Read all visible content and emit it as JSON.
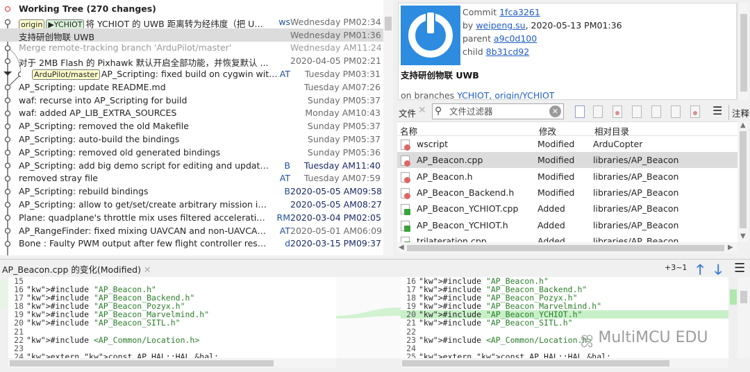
{
  "log": {
    "rows": [
      {
        "subject": "Working Tree (270 changes)",
        "author": "",
        "date": "",
        "style": "bold",
        "dot": "red"
      },
      {
        "tags": [
          "origin",
          "▶YCHIOT"
        ],
        "subject": "将 YCHIOT 的 UWB 距离转为经纬度（把 UWB ...",
        "author": "ws",
        "date": "Wednesday PM02:34"
      },
      {
        "subject": "支持研创物联 UWB",
        "author": "",
        "date": "Wednesday PM01:36",
        "selected": true
      },
      {
        "subject": "Merge remote-tracking branch 'ArduPilot/master'",
        "author": "",
        "date": "Wednesday AM11:24",
        "style": "dim"
      },
      {
        "subject": "对于 2MB Flash 的 Pixhawk 默认开启全部功能，并恢复默认 ...",
        "author": "",
        "date": "2020-04-05 PM02:21"
      },
      {
        "tags": [
          "ArduPilot/master"
        ],
        "subject": "AP_Scripting: fixed build on cygwin with ...",
        "author": "AT",
        "date": "Tuesday PM03:31"
      },
      {
        "subject": "AP_Scripting: update README.md",
        "author": "",
        "date": "Tuesday AM07:26"
      },
      {
        "subject": "waf: recurse into AP_Scripting for build",
        "author": "",
        "date": "Sunday PM05:37"
      },
      {
        "subject": "waf: added AP_LIB_EXTRA_SOURCES",
        "author": "",
        "date": "Monday AM10:43"
      },
      {
        "subject": "AP_Scripting: removed the old Makefile",
        "author": "",
        "date": "Sunday PM05:37"
      },
      {
        "subject": "AP_Scripting: auto-build the bindings",
        "author": "",
        "date": "Sunday PM05:37"
      },
      {
        "subject": "AP_Scripting: removed old generated bindings",
        "author": "",
        "date": "Sunday PM05:36"
      },
      {
        "subject": "AP_Scripting: add big demo script for editing and updating ...",
        "author": "B",
        "date": "Tuesday AM11:40",
        "dark": true
      },
      {
        "subject": "removed stray file",
        "author": "AT",
        "date": "Tuesday AM07:59"
      },
      {
        "subject": "AP_Scripting: rebuild bindings",
        "author": "B",
        "date": "2020-05-05 AM09:58",
        "dark": true
      },
      {
        "subject": "AP_Scripting: allow to get/set/create arbitrary mission items",
        "author": "",
        "date": "2020-05-05 AM08:27",
        "dark": true
      },
      {
        "subject": "Plane: quadplane's throttle mix uses filtered accelerations",
        "author": "RM",
        "date": "2020-03-04 PM02:05",
        "dark": true
      },
      {
        "subject": "AP_RangeFinder: fixed mixing UAVCAN and non-UAVCAN ra...",
        "author": "AT",
        "date": "2020-05-01 AM06:09"
      },
      {
        "subject": "Bone : Faulty PWM output after few flight controller restarts ...",
        "author": "d",
        "date": "2020-03-15 PM09:37",
        "dark": true
      }
    ]
  },
  "details": {
    "commit_label": "Commit",
    "commit": "1fca3261",
    "by_label": "by",
    "author": "weipeng.su",
    "author_date": ", 2020-05-13 PM01:36",
    "parent_label": "parent",
    "parent": "a9c0d100",
    "child_label": "child",
    "child": "8b31cd92",
    "title": "支持研创物联 UWB",
    "branches_label": "on branches",
    "branches": "YCHIOT, origin/YCHIOT"
  },
  "files_toolbar": {
    "label": "文件",
    "filter_placeholder": "文件过滤器",
    "annotate": "注释"
  },
  "files": {
    "columns": [
      "名称",
      "修改",
      "相对目录"
    ],
    "rows": [
      {
        "name": "wscript",
        "status": "Modified",
        "dir": "ArduCopter",
        "kind": "mod"
      },
      {
        "name": "AP_Beacon.cpp",
        "status": "Modified",
        "dir": "libraries/AP_Beacon",
        "kind": "mod",
        "selected": true
      },
      {
        "name": "AP_Beacon.h",
        "status": "Modified",
        "dir": "libraries/AP_Beacon",
        "kind": "mod"
      },
      {
        "name": "AP_Beacon_Backend.h",
        "status": "Modified",
        "dir": "libraries/AP_Beacon",
        "kind": "mod"
      },
      {
        "name": "AP_Beacon_YCHIOT.cpp",
        "status": "Added",
        "dir": "libraries/AP_Beacon",
        "kind": "add"
      },
      {
        "name": "AP_Beacon_YCHIOT.h",
        "status": "Added",
        "dir": "libraries/AP_Beacon",
        "kind": "add"
      },
      {
        "name": "trilateration.cpp",
        "status": "Added",
        "dir": "libraries/AP_Beacon",
        "kind": "add"
      }
    ]
  },
  "diff": {
    "title": "AP_Beacon.cpp 的变化(Modified)",
    "count": "+3~1",
    "left": [
      {
        "no": "15",
        "code": ""
      },
      {
        "no": "16",
        "code": "#include \"AP_Beacon.h\""
      },
      {
        "no": "17",
        "code": "#include \"AP_Beacon_Backend.h\""
      },
      {
        "no": "18",
        "code": "#include \"AP_Beacon_Pozyx.h\""
      },
      {
        "no": "19",
        "code": "#include \"AP_Beacon_Marvelmind.h\""
      },
      {
        "no": "20",
        "code": "#include \"AP_Beacon_SITL.h\""
      },
      {
        "no": "21",
        "code": ""
      },
      {
        "no": "22",
        "code": "#include <AP_Common/Location.h>"
      },
      {
        "no": "23",
        "code": ""
      },
      {
        "no": "24",
        "code": "extern const AP_HAL::HAL &hal;"
      }
    ],
    "right": [
      {
        "no": "16",
        "code": "#include \"AP_Beacon.h\""
      },
      {
        "no": "17",
        "code": "#include \"AP_Beacon_Backend.h\""
      },
      {
        "no": "18",
        "code": "#include \"AP_Beacon_Pozyx.h\""
      },
      {
        "no": "19",
        "code": "#include \"AP_Beacon_Marvelmind.h\""
      },
      {
        "no": "20",
        "code": "#include \"AP_Beacon_YCHIOT.h\"",
        "hl": true
      },
      {
        "no": "21",
        "code": "#include \"AP_Beacon_SITL.h\""
      },
      {
        "no": "22",
        "code": ""
      },
      {
        "no": "23",
        "code": "#include <AP_Common/Location.h>"
      },
      {
        "no": "24",
        "code": ""
      },
      {
        "no": "25",
        "code": "extern const AP_HAL::HAL &hal;"
      }
    ]
  },
  "watermark": "MultiMCU EDU",
  "colors": {
    "accent": "#1f5bc8",
    "selection": "#dcdcdc",
    "added_line": "#c8f0c8",
    "avatar": "#2d8be0"
  }
}
